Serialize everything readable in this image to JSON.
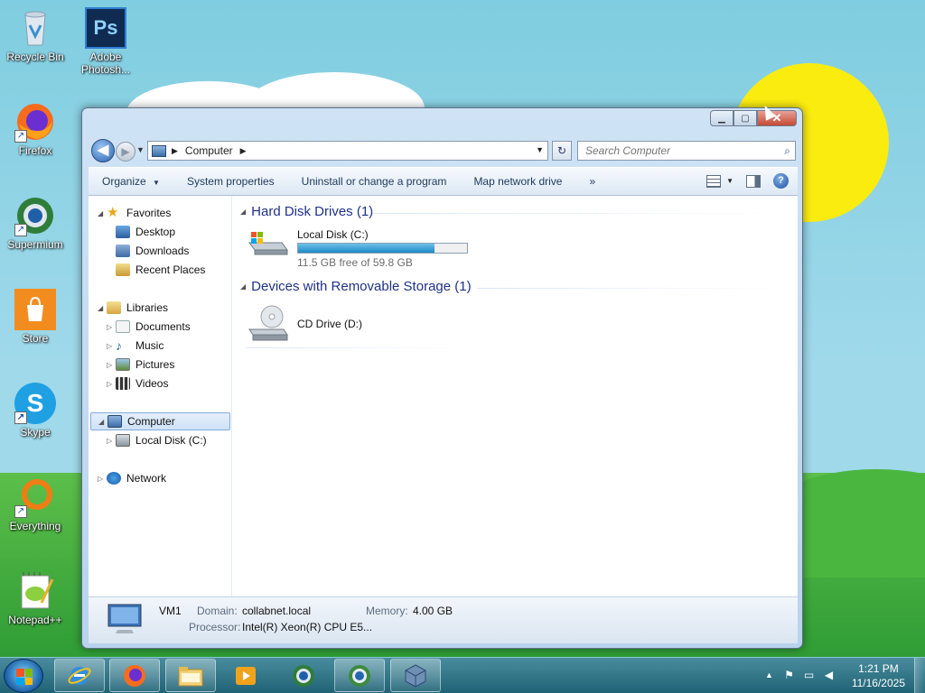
{
  "desktop": {
    "icons": [
      {
        "label": "Recycle Bin",
        "icon": "recycle-bin-icon"
      },
      {
        "label": "Adobe Photosh...",
        "icon": "photoshop-icon",
        "glyph": "Ps"
      },
      {
        "label": "Firefox",
        "icon": "firefox-icon"
      },
      {
        "label": "Supermium",
        "icon": "supermium-icon"
      },
      {
        "label": "Store",
        "icon": "store-icon"
      },
      {
        "label": "Skype",
        "icon": "skype-icon",
        "glyph": "S"
      },
      {
        "label": "Everything",
        "icon": "everything-icon"
      },
      {
        "label": "Notepad++",
        "icon": "notepadpp-icon"
      }
    ]
  },
  "window": {
    "caption_buttons": {
      "minimize": "▁",
      "maximize": "▢",
      "close": "✕"
    },
    "nav": {
      "back_glyph": "◀",
      "forward_glyph": "▶",
      "recent_glyph": "▼"
    },
    "address": {
      "location": "Computer",
      "separator": "▶",
      "dropdown_glyph": "▼"
    },
    "refresh_glyph": "↻",
    "search": {
      "placeholder": "Search Computer",
      "glyph": "⌕"
    },
    "toolbar": {
      "organize": "Organize",
      "organize_arrow": "▼",
      "system_properties": "System properties",
      "uninstall": "Uninstall or change a program",
      "map_drive": "Map network drive",
      "more": "»",
      "view_arrow": "▼",
      "help": "?"
    },
    "navpane": {
      "favorites": "Favorites",
      "desktop": "Desktop",
      "downloads": "Downloads",
      "recent_places": "Recent Places",
      "libraries": "Libraries",
      "documents": "Documents",
      "music": "Music",
      "pictures": "Pictures",
      "videos": "Videos",
      "computer": "Computer",
      "local_disk": "Local Disk (C:)",
      "network": "Network",
      "expanded_glyph": "◢",
      "collapsed_glyph": "▷"
    },
    "content": {
      "group_hdd": "Hard Disk Drives (1)",
      "group_removable": "Devices with Removable Storage (1)",
      "group_glyph": "◢",
      "local_disk": {
        "name": "Local Disk (C:)",
        "free_text": "11.5 GB free of 59.8 GB",
        "used_fraction": 0.81
      },
      "cd_drive": {
        "name": "CD Drive (D:)"
      }
    },
    "details": {
      "computer_name": "VM1",
      "domain_label": "Domain:",
      "domain_value": "collabnet.local",
      "memory_label": "Memory:",
      "memory_value": "4.00 GB",
      "processor_label": "Processor:",
      "processor_value": "Intel(R) Xeon(R) CPU E5..."
    }
  },
  "taskbar": {
    "apps": [
      "internet-explorer-icon",
      "firefox-icon",
      "file-explorer-icon",
      "media-player-icon",
      "supermium-icon",
      "chrome-like-icon",
      "virtualbox-icon"
    ],
    "tray_arrow": "▲",
    "clock": {
      "time": "1:21 PM",
      "date": "11/16/2025"
    }
  },
  "colors": {
    "accent": "#1e3287",
    "progress_fill": "#1d87c5",
    "sky": "#9fd9ea",
    "grass": "#2f9c35",
    "sun": "#fbec10"
  }
}
